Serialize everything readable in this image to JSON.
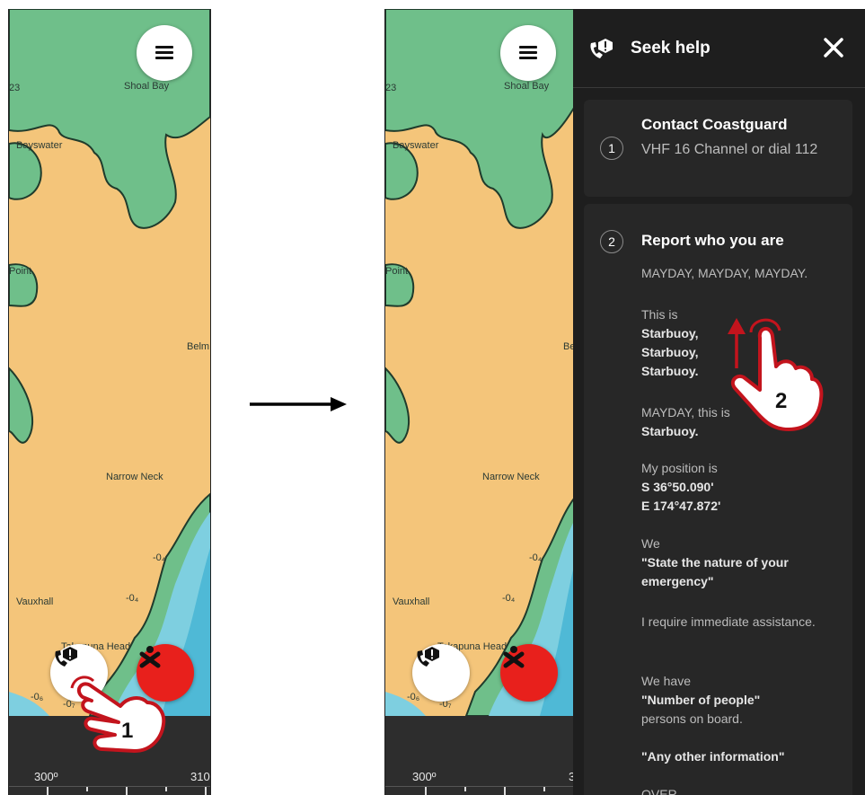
{
  "left_screen": {
    "map_labels": [
      "Shoal Bay",
      "23",
      "Bayswater",
      "Point",
      "Belm",
      "Narrow Neck",
      "Vauxhall",
      "Takapuna Head",
      "-0₄",
      "-0₄",
      "-0₆",
      "-0₇"
    ],
    "heading_labels": [
      "300º",
      "310"
    ],
    "step_label": "1"
  },
  "right_screen": {
    "map_labels": [
      "Shoal Bay",
      "23",
      "Bayswater",
      "Point",
      "Bel",
      "Narrow Neck",
      "Vauxhall",
      "Takapuna Head",
      "-0₄",
      "-0₄",
      "-0₆",
      "-0₇"
    ],
    "heading_labels": [
      "300º",
      "3"
    ]
  },
  "panel": {
    "title": "Seek help",
    "card1": {
      "number": "1",
      "title": "Contact Coastguard",
      "subtitle": "VHF 16 Channel or dial 112"
    },
    "card2": {
      "number": "2",
      "title": "Report who you are",
      "mayday": "MAYDAY, MAYDAY, MAYDAY.",
      "this_is": "This is",
      "boat_name_1": "Starbuoy,",
      "boat_name_2": "Starbuoy,",
      "boat_name_3": "Starbuoy.",
      "mayday_this_is": "MAYDAY, this is",
      "boat_name_4": "Starbuoy.",
      "position_label": "My position is",
      "latitude": "S 36°50.090'",
      "longitude": "E 174°47.872'",
      "we": "We",
      "state_nature": "\"State the nature of your emergency\"",
      "require": "I require immediate assistance.",
      "we_have": "We have",
      "number_people": "\"Number of people\"",
      "persons_on_board": "persons on board.",
      "any_other": "\"Any other information\"",
      "over": "OVER"
    },
    "step_label": "2"
  },
  "colors": {
    "land": "#f4c57a",
    "green": "#6fbf8a",
    "water": "#7ecfe0",
    "deep_water": "#4fb9d6",
    "panel_bg": "#1e1e1e",
    "card_bg": "#272727",
    "accent_red": "#e8201c"
  },
  "icons": [
    "menu-icon",
    "phone-alert-icon",
    "man-overboard-icon",
    "close-icon",
    "swipe-up-hand-icon",
    "tap-hand-icon",
    "arrow-right-icon"
  ]
}
